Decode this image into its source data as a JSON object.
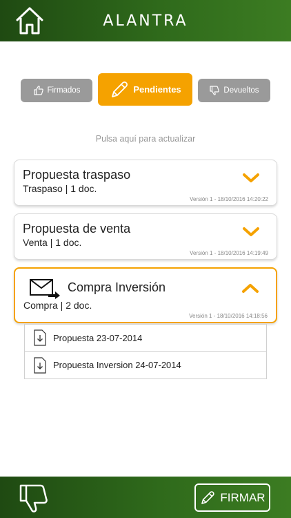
{
  "header": {
    "brand": "ALANTRA",
    "home_icon": "home-icon"
  },
  "tabs": [
    {
      "label": "Firmados",
      "icon": "thumb-up-icon",
      "state": "inactive"
    },
    {
      "label": "Pendientes",
      "icon": "pencil-icon",
      "state": "active"
    },
    {
      "label": "Devueltos",
      "icon": "thumb-down-icon",
      "state": "inactive"
    }
  ],
  "refresh_text": "Pulsa aquí para actualizar",
  "cards": [
    {
      "title": "Propuesta traspaso",
      "subtitle": "Traspaso | 1 doc.",
      "version": "Versión 1 - 18/10/2016 14:20:22",
      "expanded": false
    },
    {
      "title": "Propuesta de venta",
      "subtitle": "Venta | 1 doc.",
      "version": "Versión 1 - 18/10/2016 14:19:49",
      "expanded": false
    },
    {
      "title": "Compra Inversión",
      "subtitle": "Compra | 2 doc.",
      "version": "Versión 1 - 18/10/2016 14:18:56",
      "expanded": true,
      "icon": "envelope-send-icon"
    }
  ],
  "documents": [
    {
      "name": "Propuesta 23-07-2014",
      "icon": "download-document-icon"
    },
    {
      "name": "Propuesta Inversion 24-07-2014",
      "icon": "download-document-icon"
    }
  ],
  "footer": {
    "sign_label": "FIRMAR",
    "reject_icon": "thumb-down-icon"
  },
  "colors": {
    "accent": "#f5a200",
    "bar_green": "#2f6a1b",
    "tab_gray": "#9a9a9a"
  }
}
